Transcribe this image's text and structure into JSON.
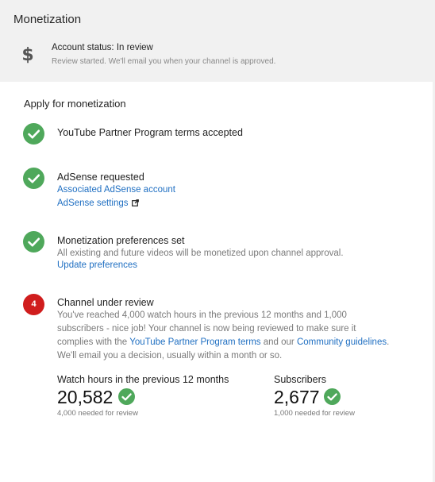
{
  "header": {
    "title": "Monetization",
    "status_label": "Account status: In review",
    "status_sub": "Review started. We'll email you when your channel is approved.",
    "status_icon": "dollar-icon"
  },
  "apply": {
    "section_title": "Apply for monetization",
    "steps": [
      {
        "title": "YouTube Partner Program terms accepted",
        "state": "done"
      },
      {
        "title": "AdSense requested",
        "state": "done",
        "links": [
          "Associated AdSense account",
          "AdSense settings"
        ]
      },
      {
        "title": "Monetization preferences set",
        "state": "done",
        "body": "All existing and future videos will be monetized upon channel approval.",
        "links": [
          "Update preferences"
        ]
      },
      {
        "title": "Channel under review",
        "state": "current",
        "number": "4",
        "body_1": "You've reached 4,000 watch hours in the previous 12 months and 1,000 subscribers - nice job! Your channel is now being reviewed to make sure it complies with the ",
        "link_1": "YouTube Partner Program terms",
        "body_2": " and our ",
        "link_2": "Community guidelines",
        "body_3": ". We'll email you a decision, usually within a month or so."
      }
    ]
  },
  "metrics": {
    "watch_hours": {
      "label": "Watch hours in the previous 12 months",
      "value": "20,582",
      "note": "4,000 needed for review"
    },
    "subscribers": {
      "label": "Subscribers",
      "value": "2,677",
      "note": "1,000 needed for review"
    }
  },
  "colors": {
    "success": "#4fa85b",
    "alert": "#d01d1d",
    "link": "#1f6fc2"
  }
}
